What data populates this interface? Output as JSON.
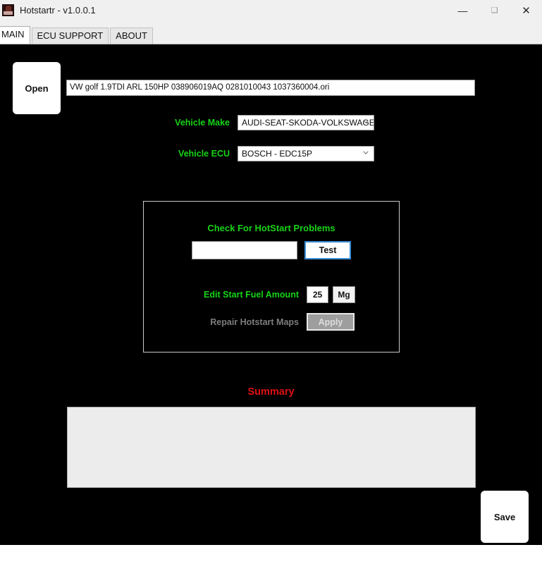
{
  "window": {
    "title": "Hotstartr - v1.0.0.1",
    "icon": "app-icon",
    "controls": {
      "minimize": "—",
      "maximize": "❑",
      "close": "✕"
    }
  },
  "tabs": [
    {
      "label": "MAIN",
      "active": true
    },
    {
      "label": "ECU SUPPORT",
      "active": false
    },
    {
      "label": "ABOUT",
      "active": false
    }
  ],
  "toolbar": {
    "open_label": "Open",
    "save_label": "Save"
  },
  "file": {
    "path_value": "VW golf 1.9TDI ARL 150HP 038906019AQ 0281010043 1037360004.ori",
    "path_placeholder": ""
  },
  "selectors": {
    "make": {
      "label": "Vehicle Make",
      "value": "AUDI-SEAT-SKODA-VOLKSWAGEN",
      "arrow_icon": "chevron-down-icon"
    },
    "ecu": {
      "label": "Vehicle ECU",
      "value": "BOSCH - EDC15P",
      "arrow_icon": "chevron-down-icon"
    }
  },
  "hotstart_panel": {
    "title": "Check For HotStart Problems",
    "check_input_value": "",
    "check_input_placeholder": "",
    "test_label": "Test",
    "fuel_label": "Edit Start Fuel Amount",
    "fuel_value": "25",
    "unit_label": "Mg",
    "repair_label": "Repair Hotstart Maps",
    "apply_label": "Apply"
  },
  "summary": {
    "title": "Summary",
    "content": ""
  },
  "colors": {
    "accent_green": "#17d317",
    "summary_red": "#e01010",
    "focus_blue": "#3a8fd8",
    "canvas_bg": "#000000",
    "disabled_gray": "#7d7d7d"
  }
}
